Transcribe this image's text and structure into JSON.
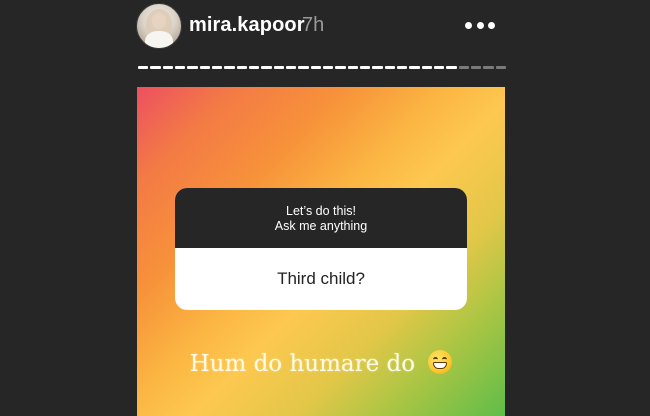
{
  "header": {
    "username": "mira.kapoor",
    "time_ago": "7h",
    "avatar_icon": "profile-avatar",
    "more_icon": "more-horizontal-icon"
  },
  "progress": {
    "total_segments": 30,
    "viewed_segments": 26
  },
  "story": {
    "background_gradient": [
      "#ec5060",
      "#f7923a",
      "#fdc84f",
      "#5fbd4a"
    ],
    "question_card": {
      "prompt_line_1": "Let’s do this!",
      "prompt_line_2": "Ask me anything",
      "answer": "Third child?"
    },
    "caption": "Hum do humare do",
    "caption_emoji": "grinning-face-emoji"
  }
}
